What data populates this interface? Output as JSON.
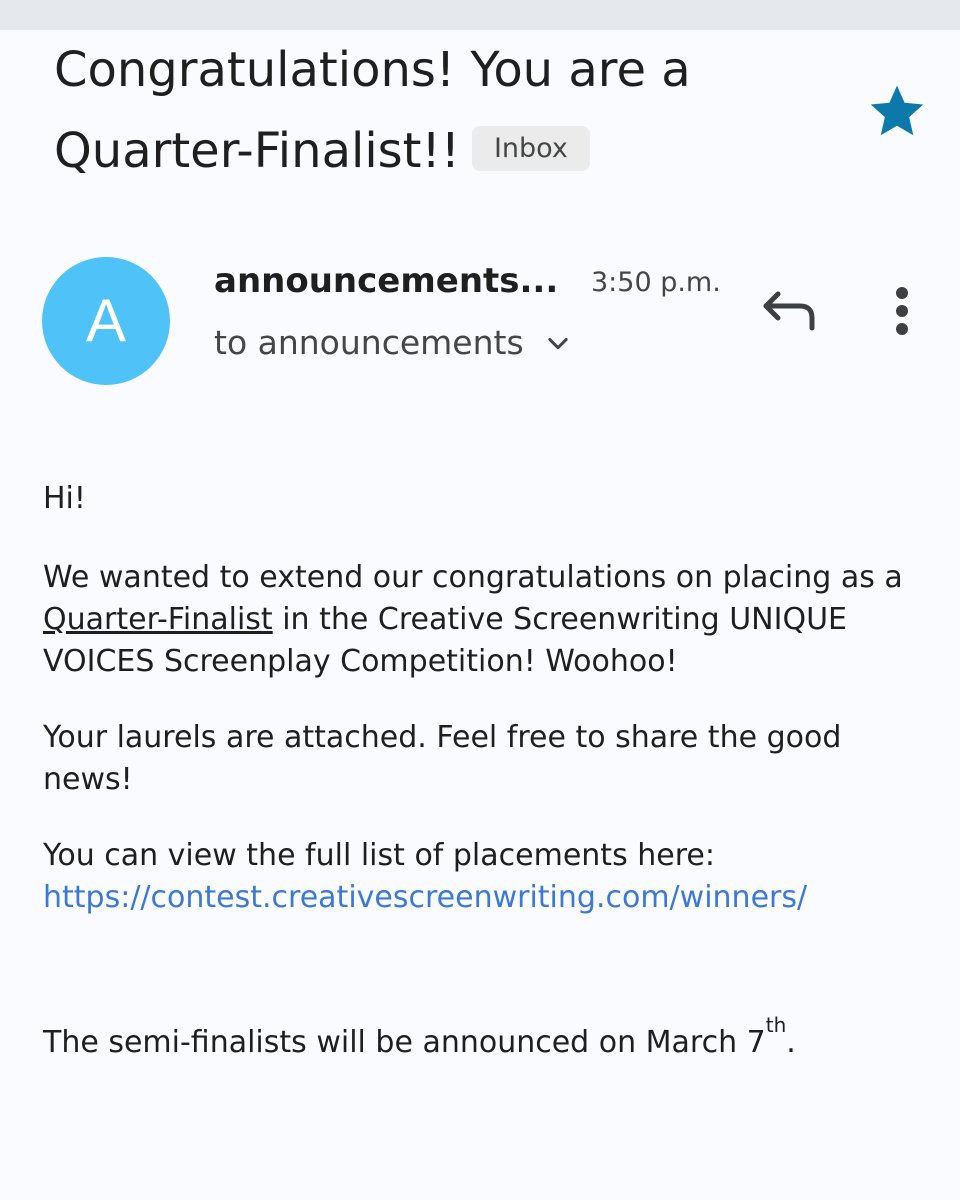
{
  "email": {
    "subject": "Congratulations! You are a Quarter-Finalist!!",
    "label": "Inbox",
    "starred": true,
    "sender": {
      "avatar_letter": "A",
      "avatar_color": "#4fc3f7",
      "name": "announcements...",
      "time": "3:50 p.m.",
      "recipient": "to announcements"
    },
    "actions": {
      "reply_icon": "reply-icon",
      "more_icon": "more-vert-icon",
      "star_icon": "star-icon"
    },
    "body": {
      "greeting": "Hi!",
      "congrats_before": "We wanted to extend our congratulations on placing as a ",
      "congrats_link": "Quarter-Finalist",
      "congrats_after": " in the Creative Screenwriting UNIQUE VOICES Screenplay Competition! Woohoo!",
      "laurels": "Your laurels are attached. Feel free to share the good news!",
      "placements_text": "You can view the full list of placements here:",
      "placements_url": "https://contest.creativescreenwriting.com/winners/",
      "semi_before": "The semi-finalists will be announced on March 7",
      "semi_sup": "th",
      "semi_after": "."
    }
  },
  "colors": {
    "accent_star": "#0b7aab",
    "link": "#3c79d6",
    "chip_bg": "#ebebeb",
    "background": "#fafbfe"
  }
}
